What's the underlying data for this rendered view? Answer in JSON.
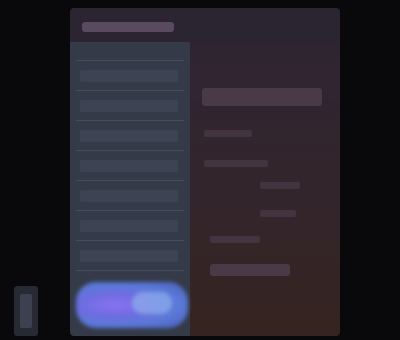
{
  "window": {
    "title": ""
  },
  "colors": {
    "background": "#09080a",
    "window_header": "#2b2431",
    "left_pane": "#343a48",
    "right_pane": "#2f2532",
    "accent_button": "#6d6ce0",
    "accent_highlight": "#8fb0ec"
  },
  "button": {
    "label": ""
  },
  "icons": {
    "side_control": "scrollbar-handle-icon"
  }
}
